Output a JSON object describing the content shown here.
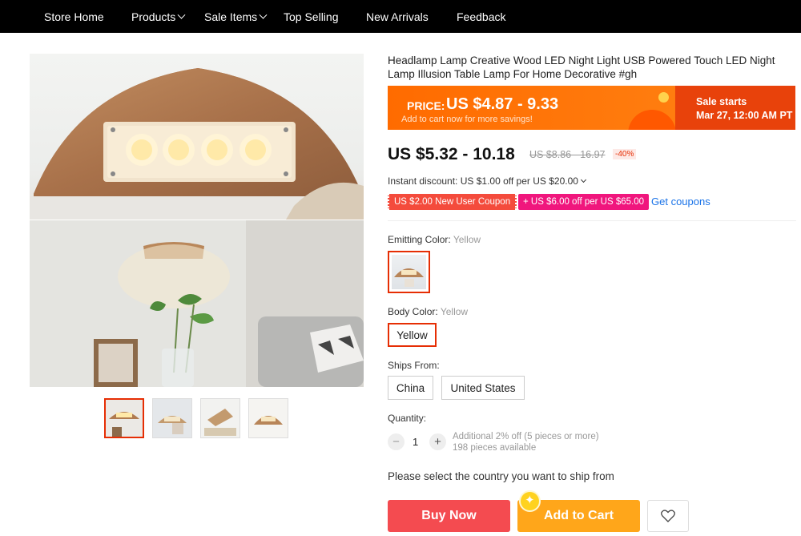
{
  "nav": {
    "items": [
      {
        "label": "Store Home",
        "dropdown": false
      },
      {
        "label": "Products",
        "dropdown": true
      },
      {
        "label": "Sale Items",
        "dropdown": true
      },
      {
        "label": "Top Selling",
        "dropdown": false
      },
      {
        "label": "New Arrivals",
        "dropdown": false
      },
      {
        "label": "Feedback",
        "dropdown": false
      }
    ]
  },
  "product": {
    "title": "Headlamp Lamp Creative Wood LED Night Light USB Powered Touch LED Night Lamp Illusion Table Lamp For Home Decorative #gh"
  },
  "promo": {
    "price_label": "PRICE:",
    "price_value": "US $4.87 - 9.33",
    "subtext": "Add to cart now for more savings!",
    "sale_line1": "Sale starts",
    "sale_line2": "Mar 27, 12:00 AM PT",
    "colors": {
      "bg": "#ff6b00",
      "sale_bg": "#e8420b"
    }
  },
  "pricing": {
    "current": "US $5.32 - 10.18",
    "original": "US $8.86 - 16.97",
    "discount": "-40%",
    "instant_discount": "Instant discount: US $1.00 off per US $20.00"
  },
  "coupons": {
    "new_user": "US $2.00 New User Coupon",
    "store": "+ US $6.00 off per US $65.00",
    "get_coupons": "Get coupons"
  },
  "options": {
    "emitting_color_label": "Emitting Color:",
    "emitting_color_value": "Yellow",
    "body_color_label": "Body Color:",
    "body_color_value": "Yellow",
    "body_color_option": "Yellow",
    "ships_from_label": "Ships From:",
    "ships_from_options": [
      "China",
      "United States"
    ]
  },
  "quantity": {
    "label": "Quantity:",
    "minus": "−",
    "plus": "+",
    "value": "1",
    "note1": "Additional 2% off (5 pieces or more)",
    "note2": "198 pieces available"
  },
  "shipping": {
    "message": "Please select the country you want to ship from"
  },
  "actions": {
    "buy_now": "Buy Now",
    "add_to_cart": "Add to Cart",
    "wishlist_icon": "heart-icon"
  },
  "colors": {
    "accent_red": "#e62e04",
    "buy_now": "#f44b50",
    "add_to_cart": "#ffa61a",
    "link": "#1a73e8"
  }
}
